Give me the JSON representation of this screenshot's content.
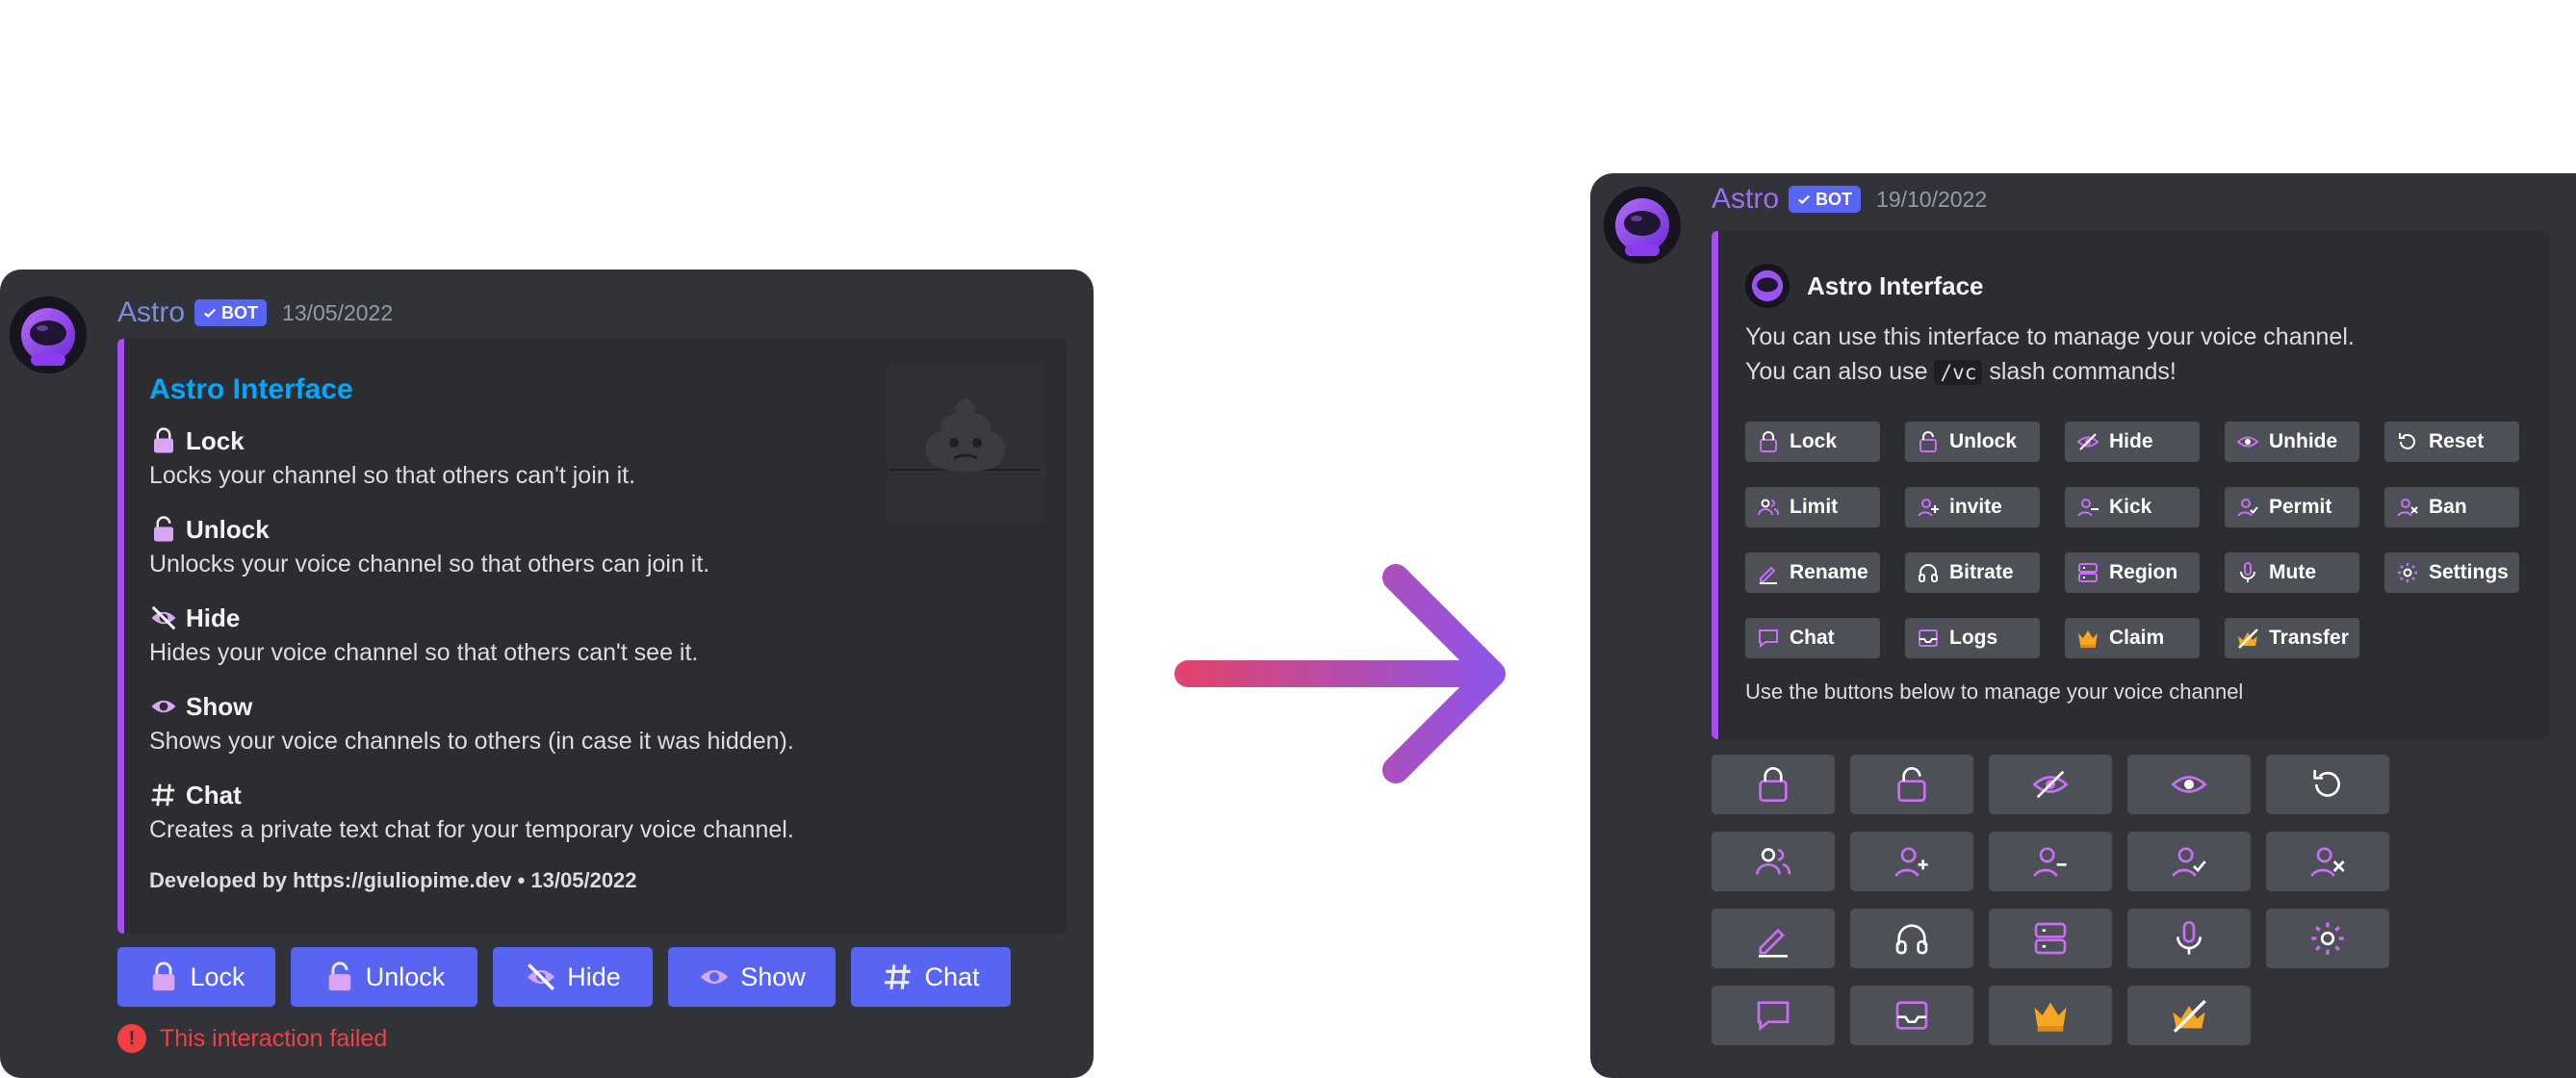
{
  "colors": {
    "blurple": "#5865f2",
    "embed_accent": "#a64df0",
    "username": "#9b6ef3",
    "error": "#f23f43",
    "link": "#00a8fc",
    "grey_button": "#4e5058",
    "icon_purple": "#c96ef5",
    "icon_gold": "#f5a623"
  },
  "before": {
    "username": "Astro",
    "bot_badge": "BOT",
    "timestamp": "13/05/2022",
    "embed": {
      "title": "Astro Interface",
      "fields": [
        {
          "icon": "lock-icon",
          "name": "Lock",
          "value": "Locks your channel so that others can't join it."
        },
        {
          "icon": "unlock-icon",
          "name": "Unlock",
          "value": "Unlocks your voice channel so that others can join it."
        },
        {
          "icon": "eye-off-icon",
          "name": "Hide",
          "value": "Hides your voice channel so that others can't see it."
        },
        {
          "icon": "eye-icon",
          "name": "Show",
          "value": "Shows your voice channels to others (in case it was hidden)."
        },
        {
          "icon": "hash-icon",
          "name": "Chat",
          "value": "Creates a private text chat for your temporary voice channel."
        }
      ],
      "footer": "Developed by https://giuliopime.dev • 13/05/2022",
      "thumbnail_icon": "poop-emoji-icon"
    },
    "buttons": [
      {
        "icon": "lock-icon",
        "label": "Lock"
      },
      {
        "icon": "unlock-icon",
        "label": "Unlock"
      },
      {
        "icon": "eye-off-icon",
        "label": "Hide"
      },
      {
        "icon": "eye-icon",
        "label": "Show"
      },
      {
        "icon": "hash-icon",
        "label": "Chat"
      }
    ],
    "error": "This interaction failed"
  },
  "after": {
    "username": "Astro",
    "bot_badge": "BOT",
    "timestamp": "19/10/2022",
    "embed": {
      "author": "Astro Interface",
      "description_line1": "You can use this interface to manage your voice channel.",
      "description_line2_pre": "You can also use",
      "description_code": "/vc",
      "description_line2_post": "slash commands!",
      "chips": [
        [
          {
            "icon": "lock-icon",
            "label": "Lock"
          },
          {
            "icon": "unlock-icon",
            "label": "Unlock"
          },
          {
            "icon": "eye-off-icon",
            "label": "Hide"
          },
          {
            "icon": "eye-icon",
            "label": "Unhide"
          },
          {
            "icon": "reset-icon",
            "label": "Reset"
          }
        ],
        [
          {
            "icon": "users-icon",
            "label": "Limit"
          },
          {
            "icon": "user-plus-icon",
            "label": "invite"
          },
          {
            "icon": "user-minus-icon",
            "label": "Kick"
          },
          {
            "icon": "user-check-icon",
            "label": "Permit"
          },
          {
            "icon": "user-x-icon",
            "label": "Ban"
          }
        ],
        [
          {
            "icon": "pencil-icon",
            "label": "Rename"
          },
          {
            "icon": "headphones-icon",
            "label": "Bitrate"
          },
          {
            "icon": "server-icon",
            "label": "Region"
          },
          {
            "icon": "mic-icon",
            "label": "Mute"
          },
          {
            "icon": "gear-icon",
            "label": "Settings"
          }
        ],
        [
          {
            "icon": "chat-icon",
            "label": "Chat"
          },
          {
            "icon": "inbox-icon",
            "label": "Logs"
          },
          {
            "icon": "crown-icon",
            "label": "Claim"
          },
          {
            "icon": "transfer-icon",
            "label": "Transfer"
          }
        ]
      ],
      "note": "Use the buttons below to manage your voice channel"
    },
    "buttons": [
      [
        "lock-icon",
        "unlock-icon",
        "eye-off-icon",
        "eye-icon",
        "reset-icon"
      ],
      [
        "users-icon",
        "user-plus-icon",
        "user-minus-icon",
        "user-check-icon",
        "user-x-icon"
      ],
      [
        "pencil-icon",
        "headphones-icon",
        "server-icon",
        "mic-icon",
        "gear-icon"
      ],
      [
        "chat-icon",
        "inbox-icon",
        "crown-icon",
        "transfer-icon"
      ]
    ]
  }
}
